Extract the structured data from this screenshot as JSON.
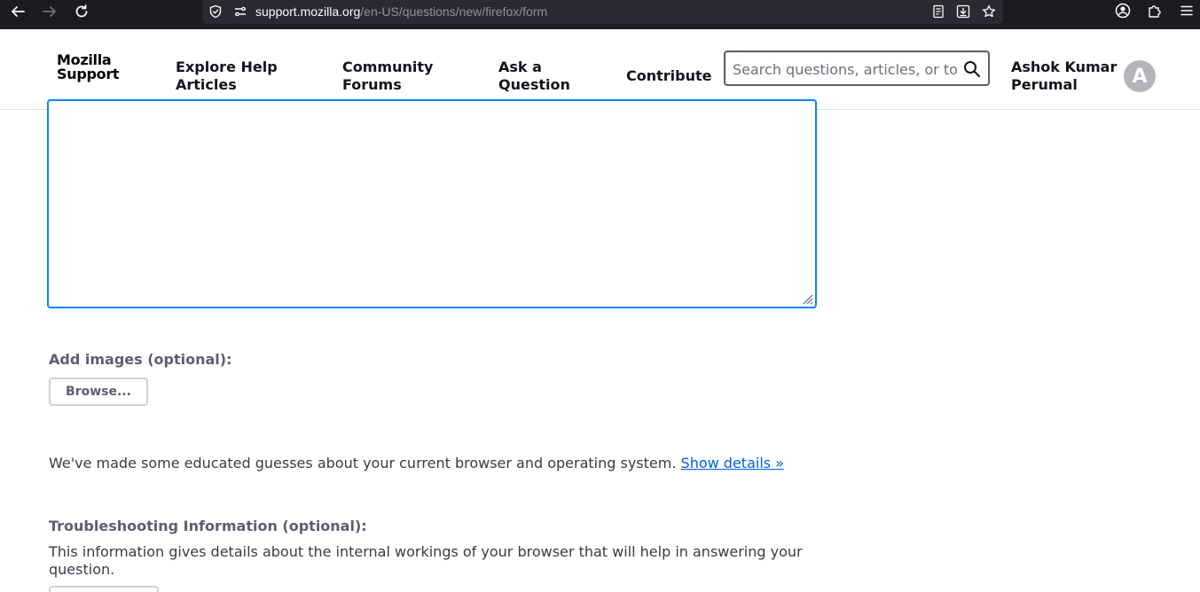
{
  "browser": {
    "url_host": "support.mozilla.org",
    "url_path": "/en-US/questions/new/firefox/form"
  },
  "header": {
    "logo_line1": "Mozilla",
    "logo_line2": "Support",
    "nav": [
      {
        "line1": "Explore Help",
        "line2": "Articles"
      },
      {
        "line1": "Community",
        "line2": "Forums"
      },
      {
        "line1": "Ask a",
        "line2": "Question"
      },
      {
        "line1": "Contribute"
      }
    ],
    "search_placeholder": "Search questions, articles, or topics",
    "user_name_line1": "Ashok Kumar",
    "user_name_line2": "Perumal",
    "avatar_letter": "A"
  },
  "form": {
    "add_images_label": "Add images (optional):",
    "browse_label": "Browse...",
    "guess_text": "We've made some educated guesses about your current browser and operating system.",
    "show_details_link": "Show details »",
    "troubleshooting_label": "Troubleshooting Information (optional):",
    "troubleshooting_desc_line1": "This information gives details about the internal workings of your browser that will help in answering your",
    "troubleshooting_desc_line2": "question."
  },
  "colors": {
    "focus_border": "#0a84ff",
    "link": "#0060df",
    "chrome_bg": "#1c1b22"
  }
}
